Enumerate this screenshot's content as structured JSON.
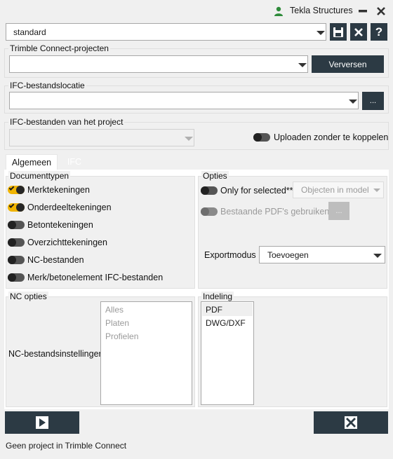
{
  "window": {
    "title": "Tekla Structures"
  },
  "toolbar": {
    "settings_value": "standard"
  },
  "trimble": {
    "label": "Trimble Connect-projecten",
    "project_value": "",
    "refresh_button": "Verversen"
  },
  "ifc_location": {
    "label": "IFC-bestandslocatie",
    "value": "",
    "browse_button": "..."
  },
  "ifc_project": {
    "label": "IFC-bestanden van het project",
    "upload_toggle_label": "Uploaden zonder te koppelen"
  },
  "tabs": [
    {
      "label": "Algemeen",
      "active": true
    },
    {
      "label": "IFC",
      "active": false
    }
  ],
  "documenttypes": {
    "label": "Documenttypen",
    "items": [
      {
        "label": "Merktekeningen",
        "on": true
      },
      {
        "label": "Onderdeeltekeningen",
        "on": true
      },
      {
        "label": "Betontekeningen",
        "on": false
      },
      {
        "label": "Overzichttekeningen",
        "on": false
      },
      {
        "label": "NC-bestanden",
        "on": false
      },
      {
        "label": "Merk/betonelement IFC-bestanden",
        "on": false
      }
    ]
  },
  "options": {
    "label": "Opties",
    "only_selected_label": "Only for selected***",
    "only_selected_dropdown": "Objecten in model",
    "existing_pdf_label": "Bestaande PDF's gebruiken",
    "existing_pdf_button": "...",
    "exportmode_label": "Exportmodus",
    "exportmode_value": "Toevoegen"
  },
  "nc_options": {
    "label": "NC opties",
    "settings_label": "NC-bestandsinstellingen",
    "items": [
      "Alles",
      "Platen",
      "Profielen"
    ]
  },
  "layout_group": {
    "label": "Indeling",
    "items": [
      "PDF",
      "DWG/DXF"
    ],
    "selected": "PDF"
  },
  "status": {
    "text": "Geen project in Trimble Connect"
  }
}
